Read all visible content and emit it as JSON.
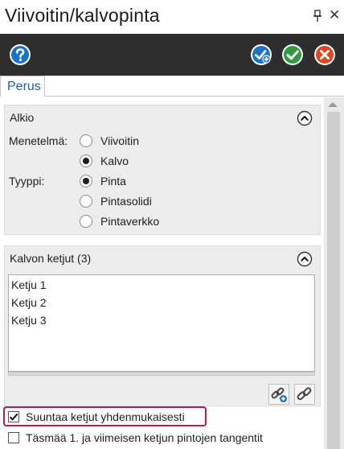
{
  "window": {
    "title": "Viivoitin/kalvopinta",
    "pin_icon": "pin-icon",
    "close_glyph": "✕"
  },
  "toolbar": {
    "help_icon": "help-icon",
    "apply_icon": "apply-and-continue-icon",
    "ok_icon": "ok-check-icon",
    "cancel_icon": "cancel-icon",
    "colors": {
      "background": "#2e2e2e",
      "blue": "#1a73c4",
      "green": "#2e9c3e",
      "red": "#e0451f"
    }
  },
  "tabs": [
    {
      "label": "Perus",
      "active": true
    }
  ],
  "alkio": {
    "title": "Alkio",
    "method_label": "Menetelmä:",
    "method_options": [
      {
        "label": "Viivoitin",
        "selected": false
      },
      {
        "label": "Kalvo",
        "selected": true
      }
    ],
    "type_label": "Tyyppi:",
    "type_options": [
      {
        "label": "Pinta",
        "selected": true
      },
      {
        "label": "Pintasolidi",
        "selected": false
      },
      {
        "label": "Pintaverkko",
        "selected": false
      }
    ]
  },
  "chains": {
    "title": "Kalvon ketjut (3)",
    "items": [
      "Ketju  1",
      "Ketju  2",
      "Ketju  3"
    ],
    "add_icon": "chain-add-icon",
    "link_icon": "chain-link-icon"
  },
  "options": {
    "align_label": "Suuntaa ketjut yhdenmukaisesti",
    "align_checked": true,
    "tangent_label": "Täsmää 1. ja viimeisen ketjun pintojen tangentit",
    "tangent_checked": false,
    "highlight_color": "#c4164f"
  }
}
